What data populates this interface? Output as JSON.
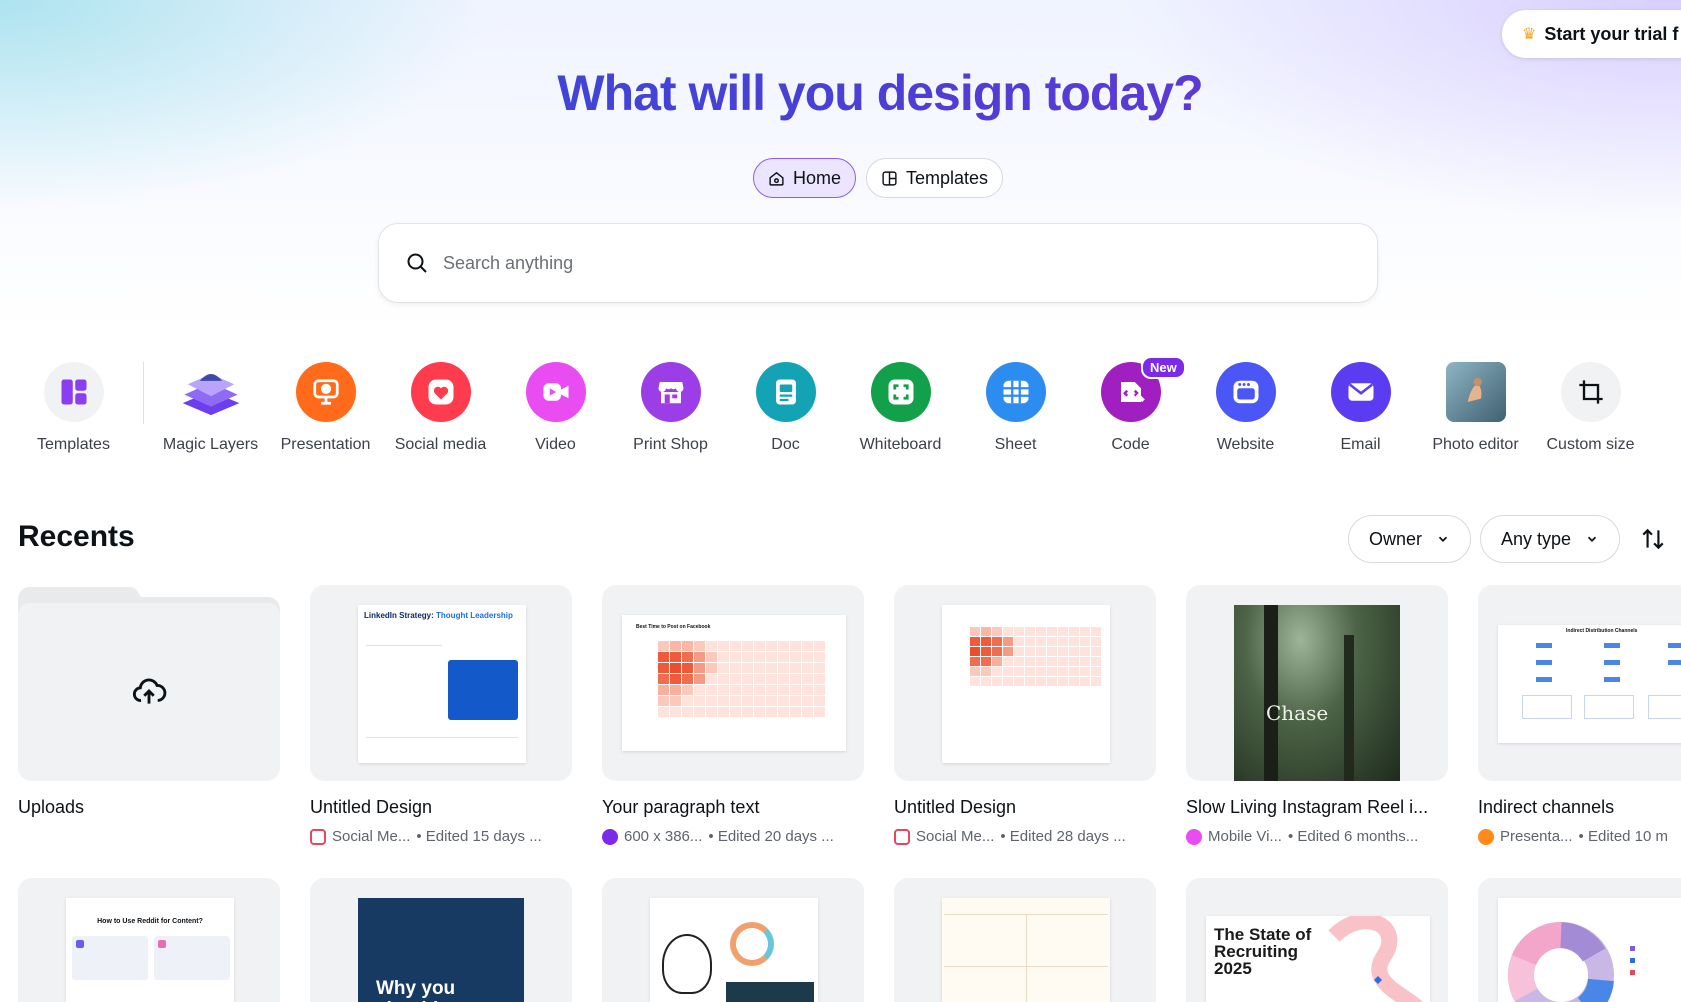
{
  "trial": {
    "label": "Start your trial f"
  },
  "hero": {
    "title": "What will you design today?"
  },
  "nav": {
    "home": "Home",
    "templates": "Templates"
  },
  "search": {
    "placeholder": "Search anything"
  },
  "shortcuts": [
    {
      "label": "Templates",
      "icon": "templates-icon",
      "color": "#f1f2f4"
    },
    {
      "label": "Magic Layers",
      "icon": "magic-layers-icon",
      "color": "#ffffff"
    },
    {
      "label": "Presentation",
      "icon": "presentation-icon",
      "color": "#ff6b1a"
    },
    {
      "label": "Social media",
      "icon": "social-media-icon",
      "color": "#ff3b4e"
    },
    {
      "label": "Video",
      "icon": "video-icon",
      "color": "#e94df2"
    },
    {
      "label": "Print Shop",
      "icon": "print-shop-icon",
      "color": "#9b3ee8"
    },
    {
      "label": "Doc",
      "icon": "doc-icon",
      "color": "#13a3b5"
    },
    {
      "label": "Whiteboard",
      "icon": "whiteboard-icon",
      "color": "#13a04a"
    },
    {
      "label": "Sheet",
      "icon": "sheet-icon",
      "color": "#2d8cf0"
    },
    {
      "label": "Code",
      "icon": "code-icon",
      "color": "#a01fc0",
      "badge": "New"
    },
    {
      "label": "Website",
      "icon": "website-icon",
      "color": "#4a56f5"
    },
    {
      "label": "Email",
      "icon": "email-icon",
      "color": "#5b3cf0"
    },
    {
      "label": "Photo editor",
      "icon": "photo-editor-icon",
      "color": "#7aa0b0"
    },
    {
      "label": "Custom size",
      "icon": "custom-size-icon",
      "color": "#f1f2f4"
    }
  ],
  "recents": {
    "title": "Recents",
    "owner_filter": "Owner",
    "type_filter": "Any type",
    "cards": [
      {
        "title": "Uploads",
        "type": "",
        "edited": ""
      },
      {
        "title": "Untitled Design",
        "type": "Social Me...",
        "edited": "• Edited 15 days ..."
      },
      {
        "title": "Your paragraph text",
        "type": "600 x 386...",
        "edited": "• Edited 20 days ..."
      },
      {
        "title": "Untitled Design",
        "type": "Social Me...",
        "edited": "• Edited 28 days ..."
      },
      {
        "title": "Slow Living Instagram Reel i...",
        "type": "Mobile Vi...",
        "edited": "• Edited 6 months..."
      },
      {
        "title": "Indirect channels",
        "type": "Presenta...",
        "edited": "• Edited 10 m"
      }
    ]
  },
  "thumb_text": {
    "linkedin_a": "LinkedIn Strategy: ",
    "linkedin_b": "Thought Leadership",
    "facebook": "Best Time to Post on Facebook",
    "chase": "Chase",
    "indirect": "Indirect Distribution Channels",
    "reddit": "How to Use Reddit for Content?",
    "why": "Why you should",
    "recruit": "The State of Recruiting 2025"
  }
}
